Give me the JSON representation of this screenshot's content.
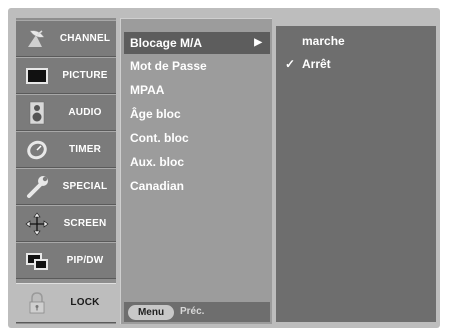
{
  "categories": [
    {
      "label": "CHANNEL",
      "icon": "satellite-dish-icon",
      "active": false
    },
    {
      "label": "PICTURE",
      "icon": "tv-screen-icon",
      "active": false
    },
    {
      "label": "AUDIO",
      "icon": "speaker-icon",
      "active": false
    },
    {
      "label": "TIMER",
      "icon": "clock-icon",
      "active": false
    },
    {
      "label": "SPECIAL",
      "icon": "wrench-icon",
      "active": false
    },
    {
      "label": "SCREEN",
      "icon": "move-arrows-icon",
      "active": false
    },
    {
      "label": "PIP/DW",
      "icon": "pip-windows-icon",
      "active": false
    },
    {
      "label": "LOCK",
      "icon": "padlock-icon",
      "active": true
    }
  ],
  "submenu": {
    "items": [
      {
        "label": "Blocage M/A",
        "selected": true
      },
      {
        "label": "Mot de Passe",
        "selected": false
      },
      {
        "label": "MPAA",
        "selected": false
      },
      {
        "label": "Âge bloc",
        "selected": false
      },
      {
        "label": "Cont. bloc",
        "selected": false
      },
      {
        "label": "Aux. bloc",
        "selected": false
      },
      {
        "label": "Canadian",
        "selected": false
      }
    ],
    "arrow": "▶",
    "footer": {
      "menu_label": "Menu",
      "back_label": "Préc."
    }
  },
  "options": {
    "items": [
      {
        "label": "marche",
        "checked": false
      },
      {
        "label": "Arrêt",
        "checked": true
      }
    ],
    "check_glyph": "✓"
  },
  "colors": {
    "frame": "#bdbdbd",
    "category_bg": "#7b7b7b",
    "category_active_bg": "#bdbdbd",
    "submenu_bg": "#9c9c9c",
    "highlight": "#5d5d5d",
    "options_bg": "#6e6e6e",
    "text": "#ffffff"
  }
}
